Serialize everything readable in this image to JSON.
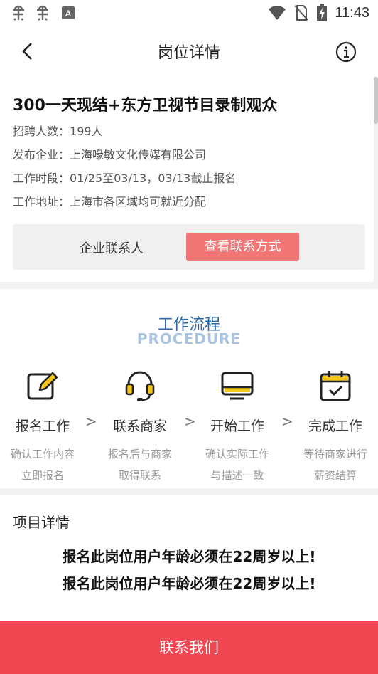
{
  "status_bar": {
    "time": "11:43",
    "icons": [
      "bug-icon",
      "bug-icon",
      "a-box-icon",
      "wifi-icon",
      "no-sim-icon",
      "battery-charging-icon"
    ]
  },
  "navbar": {
    "title": "岗位详情",
    "back_icon": "chevron-left-icon",
    "info_icon": "info-circle-icon"
  },
  "job": {
    "title": "300一天现结+东方卫视节目录制观众",
    "rows": [
      {
        "key": "招聘人数：",
        "value": "199人"
      },
      {
        "key": "发布企业：",
        "value": "上海喙敏文化传媒有限公司"
      },
      {
        "key": "工作时段：",
        "value": "01/25至03/13，03/13截止报名"
      },
      {
        "key": "工作地址：",
        "value": "上海市各区域均可就近分配"
      }
    ],
    "contact_label": "企业联系人",
    "contact_button": "查看联系方式"
  },
  "procedure": {
    "title": "工作流程",
    "subtitle": "PROCEDURE",
    "steps": [
      {
        "icon": "edit-icon",
        "name": "报名工作",
        "desc1": "确认工作内容",
        "desc2": "立即报名"
      },
      {
        "icon": "headset-icon",
        "name": "联系商家",
        "desc1": "报名后与商家",
        "desc2": "取得联系"
      },
      {
        "icon": "monitor-icon",
        "name": "开始工作",
        "desc1": "确认实际工作",
        "desc2": "与描述一致"
      },
      {
        "icon": "calendar-check-icon",
        "name": "完成工作",
        "desc1": "等待商家进行",
        "desc2": "薪资结算"
      }
    ],
    "arrow": ">"
  },
  "detail": {
    "heading": "项目详情",
    "lines": [
      "报名此岗位用户年龄必须在22周岁以上!",
      "报名此岗位用户年龄必须在22周岁以上!"
    ]
  },
  "bottom_button": "联系我们",
  "colors": {
    "accent_red": "#f04752",
    "contact_button": "#f27676",
    "procedure_title": "#2c67a8",
    "procedure_subtitle": "#a9c4e0",
    "icon_yellow": "#f5c518"
  }
}
